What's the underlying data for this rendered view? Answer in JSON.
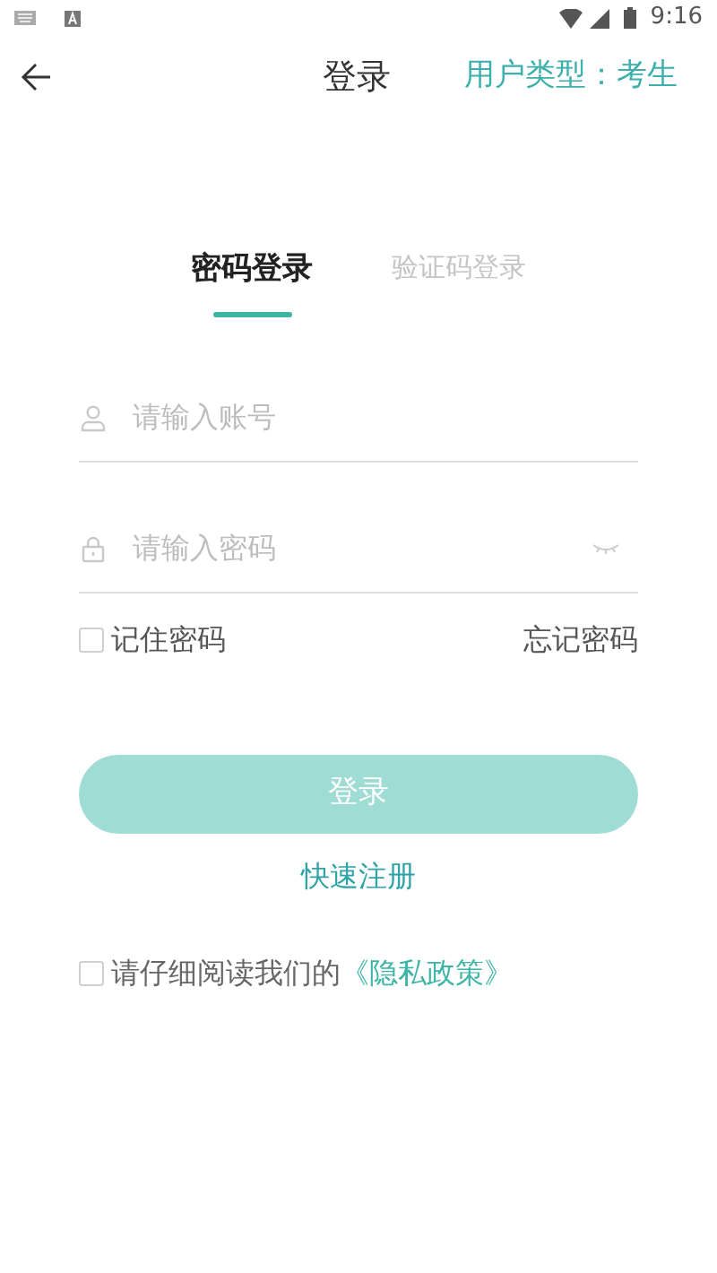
{
  "status_bar": {
    "time": "9:16"
  },
  "header": {
    "title": "登录",
    "user_type": "用户类型：考生"
  },
  "tabs": [
    {
      "label": "密码登录",
      "selected": true
    },
    {
      "label": "验证码登录",
      "selected": false
    }
  ],
  "fields": [
    {
      "kind": "account",
      "placeholder": "请输入账号"
    },
    {
      "kind": "password",
      "placeholder": "请输入密码"
    }
  ],
  "remember": {
    "label": "记住密码",
    "checked": false
  },
  "forgot": "忘记密码",
  "login_button": {
    "label": "登录",
    "disabled": true
  },
  "register": "快速注册",
  "privacy": {
    "checked": false,
    "text": "请仔细阅读我们的",
    "link": "《隐私政策》"
  }
}
